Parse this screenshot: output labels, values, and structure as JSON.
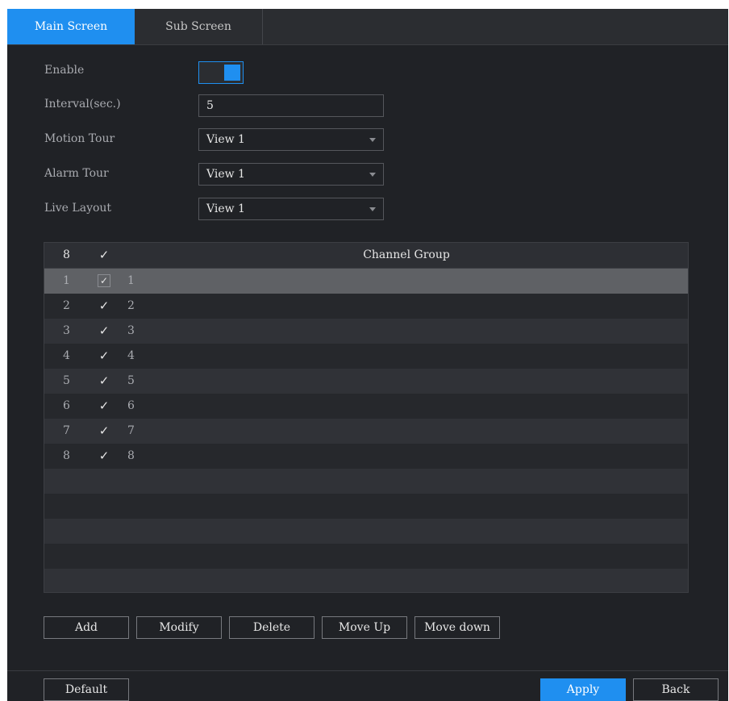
{
  "tabs": [
    {
      "label": "Main Screen",
      "active": true
    },
    {
      "label": "Sub Screen",
      "active": false
    }
  ],
  "form": {
    "enable_label": "Enable",
    "enable_on": true,
    "interval_label": "Interval(sec.)",
    "interval_value": "5",
    "motion_tour_label": "Motion Tour",
    "motion_tour_value": "View 1",
    "alarm_tour_label": "Alarm Tour",
    "alarm_tour_value": "View 1",
    "live_layout_label": "Live Layout",
    "live_layout_value": "View 1"
  },
  "table": {
    "header_count": "8",
    "header_check": "✓",
    "header_title": "Channel Group",
    "rows": [
      {
        "num": "1",
        "check": "✓",
        "group": "1"
      },
      {
        "num": "2",
        "check": "✓",
        "group": "2"
      },
      {
        "num": "3",
        "check": "✓",
        "group": "3"
      },
      {
        "num": "4",
        "check": "✓",
        "group": "4"
      },
      {
        "num": "5",
        "check": "✓",
        "group": "5"
      },
      {
        "num": "6",
        "check": "✓",
        "group": "6"
      },
      {
        "num": "7",
        "check": "✓",
        "group": "7"
      },
      {
        "num": "8",
        "check": "✓",
        "group": "8"
      }
    ]
  },
  "actions": {
    "add": "Add",
    "modify": "Modify",
    "delete": "Delete",
    "move_up": "Move Up",
    "move_down": "Move down"
  },
  "footer": {
    "default": "Default",
    "apply": "Apply",
    "back": "Back"
  },
  "colors": {
    "accent": "#1f8ff0",
    "background": "#202226",
    "selected_row": "#5f6165"
  },
  "icons": {
    "checkmark": "checkmark-icon",
    "dropdown": "chevron-down-icon"
  }
}
